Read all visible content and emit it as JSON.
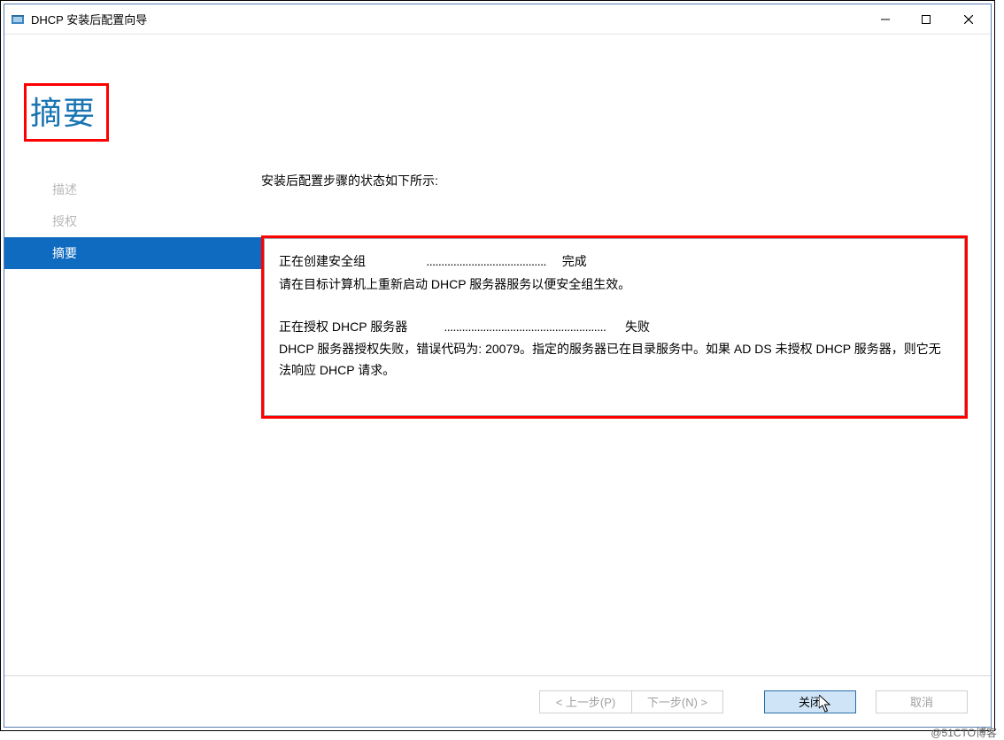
{
  "window": {
    "title": "DHCP 安装后配置向导"
  },
  "heading": "摘要",
  "sidebar": {
    "items": [
      {
        "label": "描述"
      },
      {
        "label": "授权"
      },
      {
        "label": "摘要"
      }
    ],
    "active_index": 2
  },
  "main": {
    "intro": "安装后配置步骤的状态如下所示:",
    "status1_task": "正在创建安全组",
    "status1_dots": "........................................",
    "status1_result": "完成",
    "status1_note": "请在目标计算机上重新启动 DHCP 服务器服务以便安全组生效。",
    "status2_task": "正在授权 DHCP 服务器",
    "status2_dots": "......................................................",
    "status2_result": "失败",
    "status2_note": "DHCP 服务器授权失败，错误代码为: 20079。指定的服务器已在目录服务中。如果 AD DS 未授权 DHCP 服务器，则它无法响应 DHCP 请求。"
  },
  "footer": {
    "prev": "< 上一步(P)",
    "next": "下一步(N) >",
    "close": "关闭",
    "cancel": "取消"
  },
  "watermark": "@51CTO博客"
}
